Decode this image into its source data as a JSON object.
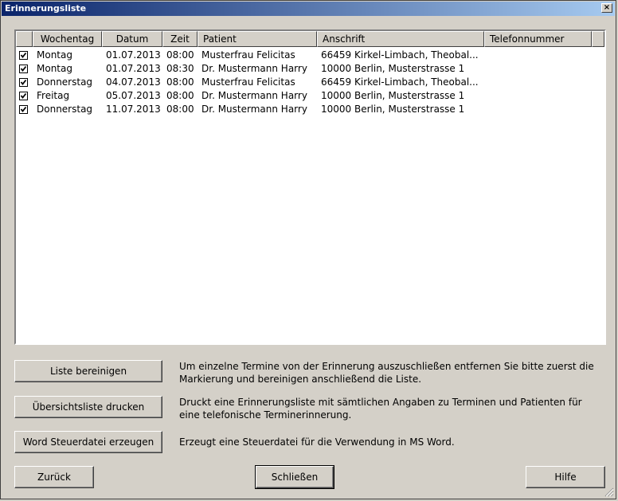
{
  "window": {
    "title": "Erinnerungsliste",
    "close_label": "×"
  },
  "table": {
    "columns": [
      "Wochentag",
      "Datum",
      "Zeit",
      "Patient",
      "Anschrift",
      "Telefonnummer"
    ],
    "rows": [
      {
        "checked": true,
        "day": "Montag",
        "date": "01.07.2013",
        "time": "08:00",
        "patient": "Musterfrau Felicitas",
        "address": "66459 Kirkel-Limbach, Theobal...",
        "phone": ""
      },
      {
        "checked": true,
        "day": "Montag",
        "date": "01.07.2013",
        "time": "08:30",
        "patient": "Dr. Mustermann Harry",
        "address": "10000 Berlin, Musterstrasse 1",
        "phone": ""
      },
      {
        "checked": true,
        "day": "Donnerstag",
        "date": "04.07.2013",
        "time": "08:00",
        "patient": "Musterfrau Felicitas",
        "address": "66459 Kirkel-Limbach, Theobal...",
        "phone": ""
      },
      {
        "checked": true,
        "day": "Freitag",
        "date": "05.07.2013",
        "time": "08:00",
        "patient": "Dr. Mustermann Harry",
        "address": "10000 Berlin, Musterstrasse 1",
        "phone": ""
      },
      {
        "checked": true,
        "day": "Donnerstag",
        "date": "11.07.2013",
        "time": "08:00",
        "patient": "Dr. Mustermann Harry",
        "address": "10000 Berlin, Musterstrasse 1",
        "phone": ""
      }
    ]
  },
  "actions": {
    "clean": {
      "label": "Liste bereinigen",
      "description": "Um einzelne Termine von der Erinnerung auszuschließen entfernen Sie bitte zuerst die Markierung und bereinigen anschließend die Liste."
    },
    "print": {
      "label": "Übersichtsliste drucken",
      "description": "Druckt eine Erinnerungsliste mit sämtlichen Angaben zu Terminen und Patienten für eine telefonische Terminerinnerung."
    },
    "word": {
      "label": "Word Steuerdatei erzeugen",
      "description": "Erzeugt eine Steuerdatei für die Verwendung in MS Word."
    }
  },
  "footer": {
    "back_label": "Zurück",
    "close_label": "Schließen",
    "help_label": "Hilfe"
  }
}
